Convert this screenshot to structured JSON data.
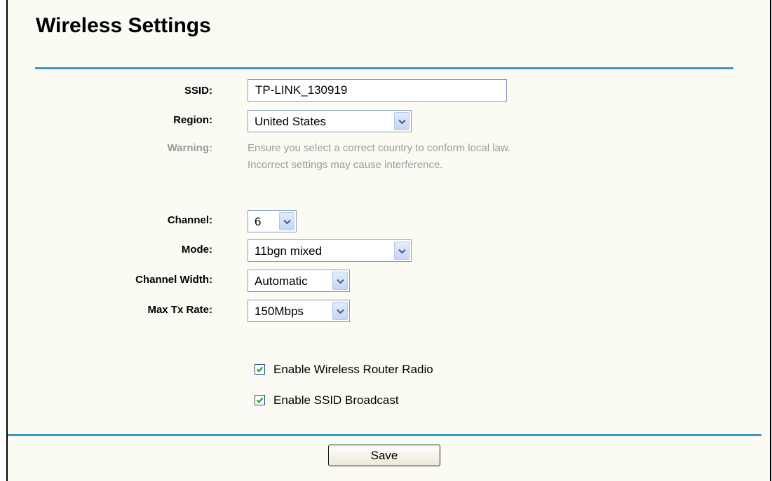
{
  "page": {
    "title": "Wireless Settings"
  },
  "form": {
    "ssid": {
      "label": "SSID:",
      "value": "TP-LINK_130919"
    },
    "region": {
      "label": "Region:",
      "value": "United States"
    },
    "warning": {
      "label": "Warning:",
      "line1": "Ensure you select a correct country to conform local law.",
      "line2": "Incorrect settings may cause interference."
    },
    "channel": {
      "label": "Channel:",
      "value": "6"
    },
    "mode": {
      "label": "Mode:",
      "value": "11bgn mixed"
    },
    "channel_width": {
      "label": "Channel Width:",
      "value": "Automatic"
    },
    "max_tx_rate": {
      "label": "Max Tx Rate:",
      "value": "150Mbps"
    },
    "enable_radio": {
      "label": "Enable Wireless Router Radio",
      "checked": true
    },
    "enable_ssid_broadcast": {
      "label": "Enable SSID Broadcast",
      "checked": true
    }
  },
  "actions": {
    "save_label": "Save"
  },
  "colors": {
    "accent_rule": "#3a98c6",
    "panel_bg": "#fbfbf4",
    "muted_text": "#9a9a9a"
  },
  "icons": {
    "dropdown": "chevron-down-icon",
    "checkbox": "checkmark-icon"
  }
}
